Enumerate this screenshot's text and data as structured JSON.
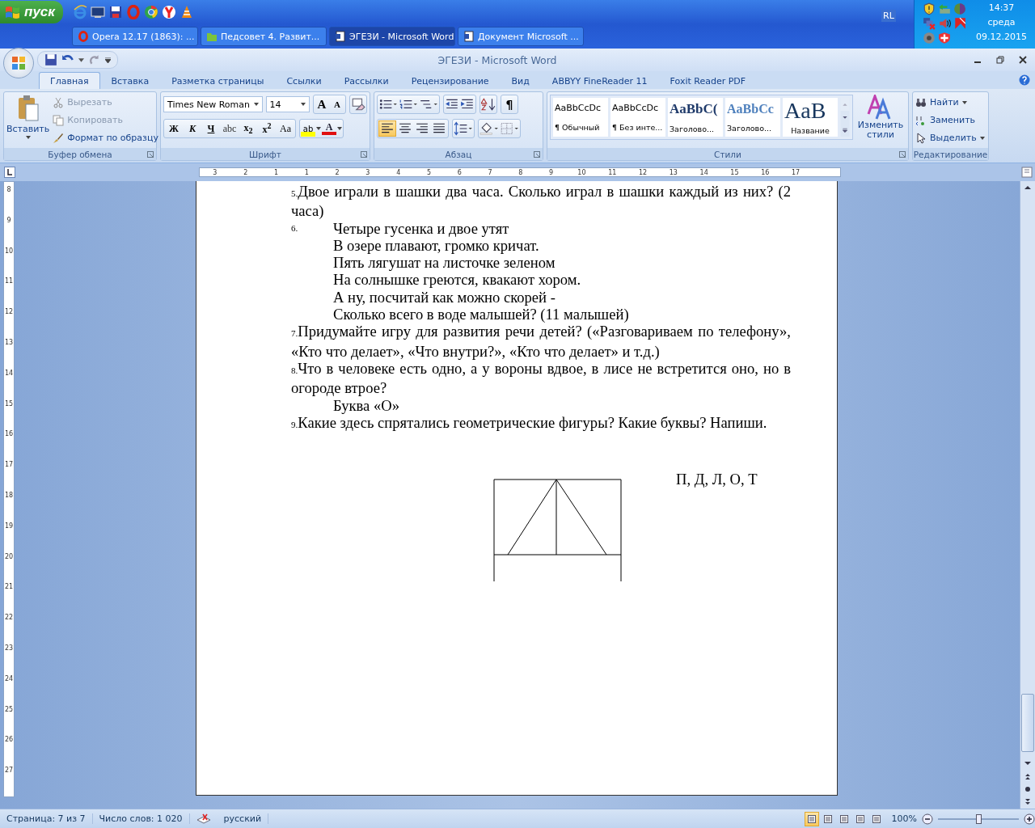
{
  "taskbar": {
    "start_label": "пуск",
    "quick_launch": [
      {
        "kind": "ie"
      },
      {
        "kind": "desktop"
      },
      {
        "kind": "save"
      },
      {
        "kind": "opera"
      },
      {
        "kind": "chrome"
      },
      {
        "kind": "yandex"
      },
      {
        "kind": "vlc"
      }
    ],
    "windows": [
      {
        "kind": "opera",
        "label": "Opera 12.17 (1863): ...",
        "selected": false
      },
      {
        "kind": "folder",
        "label": "Педсовет 4. Развит...",
        "selected": false
      },
      {
        "kind": "word",
        "label": "ЭГЕЗИ - Microsoft Word",
        "selected": true
      },
      {
        "kind": "word",
        "label": "Документ Microsoft ...",
        "selected": false
      }
    ],
    "language": "RL",
    "time": "14:37",
    "day": "среда",
    "date": "09.12.2015"
  },
  "window": {
    "title": "ЭГЕЗИ - Microsoft Word"
  },
  "tabs": [
    {
      "label": "Главная",
      "selected": true
    },
    {
      "label": "Вставка",
      "selected": false
    },
    {
      "label": "Разметка страницы",
      "selected": false
    },
    {
      "label": "Ссылки",
      "selected": false
    },
    {
      "label": "Рассылки",
      "selected": false
    },
    {
      "label": "Рецензирование",
      "selected": false
    },
    {
      "label": "Вид",
      "selected": false
    },
    {
      "label": "ABBYY FineReader 11",
      "selected": false
    },
    {
      "label": "Foxit Reader PDF",
      "selected": false
    }
  ],
  "clipboard": {
    "title": "Буфер обмена",
    "paste": "Вставить",
    "items": [
      {
        "kind": "cut",
        "label": "Вырезать",
        "disabled": true
      },
      {
        "kind": "copy",
        "label": "Копировать",
        "disabled": true
      },
      {
        "kind": "brush",
        "label": "Формат по образцу",
        "disabled": false
      }
    ]
  },
  "font": {
    "title": "Шрифт",
    "family": "Times New Roman",
    "size": "14",
    "size_buttons": [
      "A",
      "A"
    ],
    "format_buttons": [
      {
        "kind": "bold",
        "label": "Ж"
      },
      {
        "kind": "italic",
        "label": "К"
      },
      {
        "kind": "underline",
        "label": "Ч"
      },
      {
        "kind": "strike",
        "label": "abc"
      },
      {
        "kind": "sub",
        "label": "x$_{2}$"
      },
      {
        "kind": "sup",
        "label": "x$^{2}$"
      },
      {
        "kind": "case",
        "label": "Aa"
      }
    ],
    "highlight_label": "ab",
    "color_label": "A"
  },
  "paragraph": {
    "title": "Абзац",
    "align_buttons": [
      {
        "kind": "left",
        "selected": true
      },
      {
        "kind": "center",
        "selected": false
      },
      {
        "kind": "right",
        "selected": false
      },
      {
        "kind": "justify",
        "selected": false
      }
    ],
    "show_marks": "¶"
  },
  "styles": {
    "title": "Стили",
    "items": [
      {
        "kind": "normal",
        "sample": "AaBbCcDc",
        "name": "¶ Обычный"
      },
      {
        "kind": "normal",
        "sample": "AaBbCcDc",
        "name": "¶ Без инте..."
      },
      {
        "kind": "heading1",
        "sample": "AaBbC(",
        "name": "Заголово..."
      },
      {
        "kind": "heading2",
        "sample": "AaBbCc",
        "name": "Заголово..."
      },
      {
        "kind": "title",
        "sample": "AaB",
        "name": "Название"
      }
    ],
    "change": "Изменить стили"
  },
  "editing": {
    "title": "Редактирование",
    "items": [
      {
        "kind": "find",
        "label": "Найти"
      },
      {
        "kind": "replace",
        "label": "Заменить"
      },
      {
        "kind": "select",
        "label": "Выделить"
      }
    ]
  },
  "ruler": {
    "marks": [
      "3",
      "2",
      "1",
      "1",
      "2",
      "3",
      "4",
      "5",
      "6",
      "7",
      "8",
      "9",
      "10",
      "11",
      "12",
      "13",
      "14",
      "15",
      "16",
      "17"
    ],
    "vertical_marks": [
      "8",
      "9",
      "10",
      "11",
      "12",
      "13",
      "14",
      "15",
      "16",
      "17",
      "18",
      "19",
      "20",
      "21",
      "22",
      "23",
      "24",
      "25",
      "26",
      "27"
    ]
  },
  "document": {
    "items": [
      {
        "kind": "numbered",
        "number": "5.",
        "text": "Двое играли в шашки два часа. Сколько играл в шашки каждый из них? (2 часа)"
      },
      {
        "kind": "verse",
        "number": "6.",
        "lines": [
          "Четыре гусенка и двое утят",
          "В озере плавают, громко кричат.",
          "Пять лягушат на листочке зеленом",
          "На солнышке греются, квакают хором.",
          "А ну, посчитай как можно скорей -",
          "Сколько всего в воде малышей? (11 малышей)"
        ]
      },
      {
        "kind": "numbered",
        "number": "7.",
        "text": "Придумайте игру для развития речи детей? («Разговариваем по телефону», «Кто что делает», «Что внутри?», «Кто что делает» и т.д.)"
      },
      {
        "kind": "numbered",
        "number": "8.",
        "text": "Что в человеке есть одно, а у вороны вдвое, в лисе не встретится оно, но в огороде втрое?"
      },
      {
        "kind": "answer",
        "text": "Буква «О»"
      },
      {
        "kind": "numbered",
        "number": "9.",
        "text": "Какие здесь спрятались геометрические фигуры? Какие буквы? Напиши."
      }
    ],
    "figure_answer": "П, Д, Л, О, Т"
  },
  "status_bar": {
    "items": [
      "Страница: 7 из 7",
      "Число слов: 1 020",
      "русский"
    ],
    "views": [
      {
        "selected": true
      },
      {
        "selected": false
      },
      {
        "selected": false
      },
      {
        "selected": false
      },
      {
        "selected": false
      }
    ],
    "zoom": "100%",
    "zoom_level": {
      "level": 0.5
    }
  }
}
